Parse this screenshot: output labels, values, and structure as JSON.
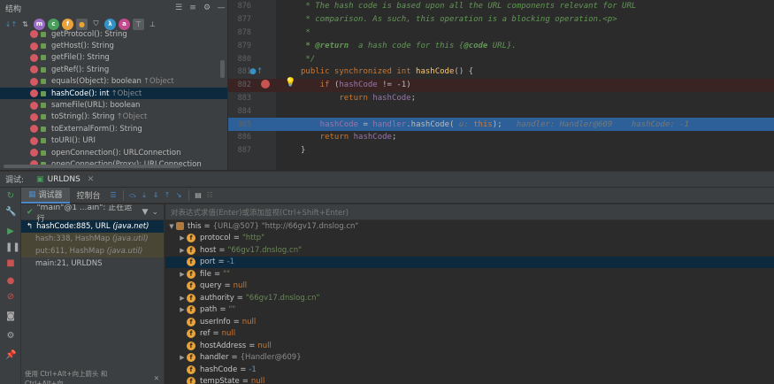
{
  "structure": {
    "title": "结构",
    "members": [
      {
        "name": "getProtocol(): String",
        "type": ""
      },
      {
        "name": "getHost(): String",
        "type": ""
      },
      {
        "name": "getFile(): String",
        "type": ""
      },
      {
        "name": "getRef(): String",
        "type": ""
      },
      {
        "name": "equals(Object): boolean",
        "type": "↑Object"
      },
      {
        "name": "hashCode(): int",
        "type": "↑Object"
      },
      {
        "name": "sameFile(URL): boolean",
        "type": ""
      },
      {
        "name": "toString(): String",
        "type": "↑Object"
      },
      {
        "name": "toExternalForm(): String",
        "type": ""
      },
      {
        "name": "toURI(): URI",
        "type": ""
      },
      {
        "name": "openConnection(): URLConnection",
        "type": ""
      },
      {
        "name": "openConnection(Proxy): URLConnection",
        "type": ""
      }
    ]
  },
  "editor": {
    "lines": [
      {
        "num": "876",
        "segments": [
          [
            "cm",
            " * The hash code is based upon all the URL components relevant for URL"
          ]
        ]
      },
      {
        "num": "877",
        "segments": [
          [
            "cm",
            " * comparison. As such, this operation is a blocking operation.<p>"
          ]
        ]
      },
      {
        "num": "878",
        "segments": [
          [
            "cm",
            " *"
          ]
        ]
      },
      {
        "num": "879",
        "segments": [
          [
            "cmt",
            " * @return"
          ],
          [
            "cm",
            "  a hash code for this {"
          ],
          [
            "cmt",
            "@code"
          ],
          [
            "cm",
            " URL}."
          ]
        ]
      },
      {
        "num": "880",
        "segments": [
          [
            "cm",
            " */"
          ]
        ]
      },
      {
        "num": "881",
        "segments": [
          [
            "kw",
            "public synchronized int "
          ],
          [
            "fn",
            "hashCode"
          ],
          [
            "plain",
            "() {"
          ]
        ]
      },
      {
        "num": "882",
        "segments": [
          [
            "kw",
            "    if "
          ],
          [
            "plain",
            "("
          ],
          [
            "fld",
            "hashCode"
          ],
          [
            "plain",
            " != -1)"
          ]
        ]
      },
      {
        "num": "883",
        "segments": [
          [
            "kw",
            "        return "
          ],
          [
            "fld",
            "hashCode"
          ],
          [
            "plain",
            ";"
          ]
        ]
      },
      {
        "num": "884",
        "segments": []
      },
      {
        "num": "885",
        "segments": [
          [
            "fld",
            "    hashCode"
          ],
          [
            "plain",
            " = "
          ],
          [
            "fld",
            "handler"
          ],
          [
            "plain",
            ".hashCode( "
          ],
          [
            "hint",
            "u:"
          ],
          [
            "kw",
            " this"
          ],
          [
            "plain",
            ");   "
          ],
          [
            "hint",
            "handler: Handler@609    hashCode: -1"
          ]
        ]
      },
      {
        "num": "886",
        "segments": [
          [
            "kw",
            "    return "
          ],
          [
            "fld",
            "hashCode"
          ],
          [
            "plain",
            ";"
          ]
        ]
      },
      {
        "num": "887",
        "segments": [
          [
            "plain",
            "}"
          ]
        ]
      }
    ]
  },
  "debug": {
    "label": "调试:",
    "tab_name": "URLDNS",
    "subtab_debugger": "调试器",
    "subtab_console": "控制台",
    "thread": "\"main\"@1 ...ain\": 正在运行",
    "eval_placeholder": "对表达式求值(Enter)或添加监视(Ctrl+Shift+Enter)",
    "hint": "使用 Ctrl+Alt+向上箭头 和 Ctrl+Alt+向...",
    "frames": [
      {
        "method": "hashCode:885, URL",
        "loc": "(java.net)"
      },
      {
        "method": "hash:338, HashMap",
        "loc": "(java.util)"
      },
      {
        "method": "put:611, HashMap",
        "loc": "(java.util)"
      },
      {
        "method": "main:21, URLDNS",
        "loc": ""
      }
    ],
    "vars_root": {
      "name": "this",
      "value": "{URL@507} \"http://66gv17.dnslog.cn\""
    },
    "variables": [
      {
        "name": "protocol",
        "value": "\"http\"",
        "kind": "str",
        "expand": true
      },
      {
        "name": "host",
        "value": "\"66gv17.dnslog.cn\"",
        "kind": "str",
        "expand": true
      },
      {
        "name": "port",
        "value": "-1",
        "kind": "num",
        "expand": false
      },
      {
        "name": "file",
        "value": "\"\"",
        "kind": "str",
        "expand": true
      },
      {
        "name": "query",
        "value": "null",
        "kind": "kw",
        "expand": false
      },
      {
        "name": "authority",
        "value": "\"66gv17.dnslog.cn\"",
        "kind": "str",
        "expand": true
      },
      {
        "name": "path",
        "value": "\"\"",
        "kind": "str",
        "expand": true
      },
      {
        "name": "userInfo",
        "value": "null",
        "kind": "kw",
        "expand": false
      },
      {
        "name": "ref",
        "value": "null",
        "kind": "kw",
        "expand": false
      },
      {
        "name": "hostAddress",
        "value": "null",
        "kind": "kw",
        "expand": false
      },
      {
        "name": "handler",
        "value": "{Handler@609}",
        "kind": "obj",
        "expand": true
      },
      {
        "name": "hashCode",
        "value": "-1",
        "kind": "num",
        "expand": false
      },
      {
        "name": "tempState",
        "value": "null",
        "kind": "kw",
        "expand": false
      }
    ]
  }
}
